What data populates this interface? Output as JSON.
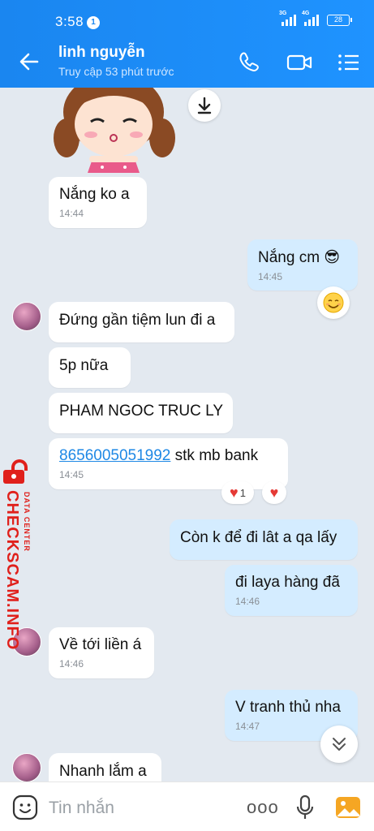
{
  "status_bar": {
    "time": "3:58",
    "notification_count": "1",
    "network_1": "3G",
    "network_2": "4G",
    "battery": "28"
  },
  "header": {
    "name": "linh nguyễn",
    "last_seen": "Truy cập 53 phút trước"
  },
  "messages": [
    {
      "text": "Nắng ko a",
      "time": "14:44",
      "direction": "in"
    },
    {
      "text": "Nắng cm 😎",
      "time": "14:45",
      "direction": "out"
    },
    {
      "text": "Đứng gần tiệm lun đi a",
      "direction": "in"
    },
    {
      "text": "5p nữa",
      "direction": "in"
    },
    {
      "text": "PHAM NGOC TRUC LY",
      "direction": "in"
    },
    {
      "link": "8656005051992",
      "text": " stk mb bank",
      "time": "14:45",
      "direction": "in"
    },
    {
      "text": "Còn k để đi lât a qa lấy",
      "direction": "out"
    },
    {
      "text": "đi laya hàng đã",
      "time": "14:46",
      "direction": "out"
    },
    {
      "text": "Về tới liền á",
      "time": "14:46",
      "direction": "in"
    },
    {
      "text": "V tranh thủ nha",
      "time": "14:47",
      "direction": "out"
    },
    {
      "text": "Nhanh lắm a",
      "direction": "in"
    }
  ],
  "reactions": {
    "heart_count": "1"
  },
  "watermark": {
    "brand": "CHECKSCAM.INFO",
    "tagline": "DATA CENTER"
  },
  "input": {
    "placeholder": "Tin nhắn",
    "more_label": "ooo"
  },
  "colors": {
    "accent": "#1a86f0",
    "outgoing_bubble": "#d4ecff",
    "background": "#e3e9f0",
    "watermark": "#e0201b"
  }
}
